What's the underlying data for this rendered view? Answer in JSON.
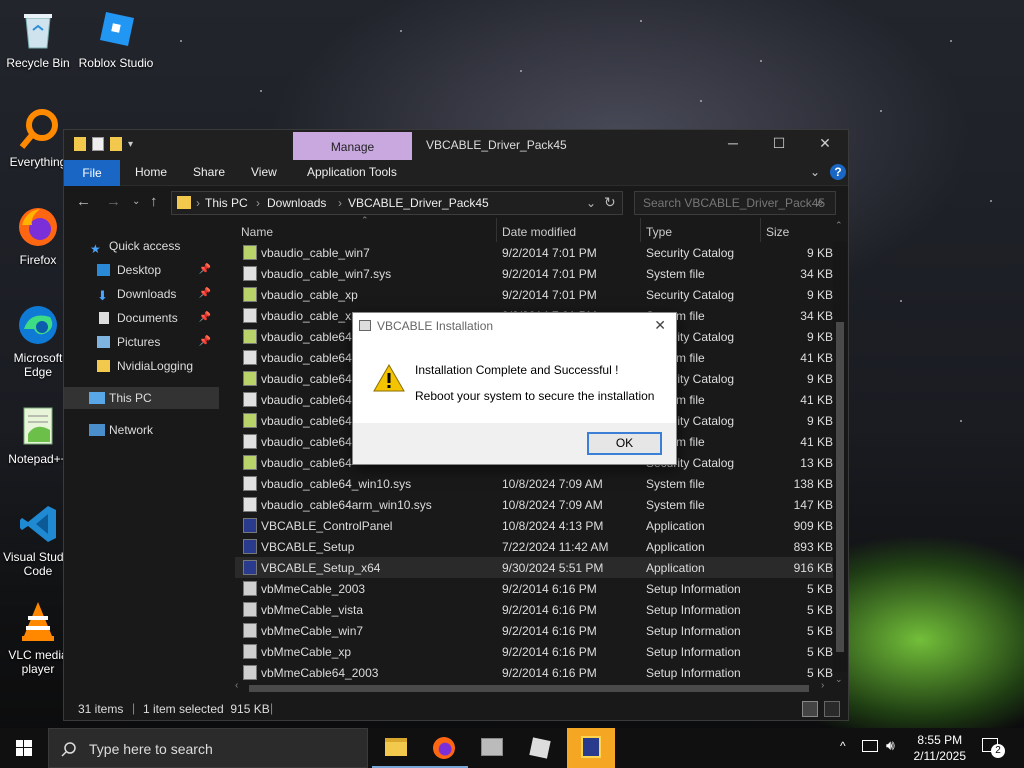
{
  "desktop": {
    "icons": [
      {
        "label": "Recycle Bin"
      },
      {
        "label": "Roblox Studio"
      },
      {
        "label": "Everything"
      },
      {
        "label": "Firefox"
      },
      {
        "label": "Microsoft Edge"
      },
      {
        "label": "Notepad++"
      },
      {
        "label": "Visual Studio Code"
      },
      {
        "label": "VLC media player"
      }
    ]
  },
  "explorer": {
    "manage_tab": "Manage",
    "title": "VBCABLE_Driver_Pack45",
    "ribbon": {
      "file": "File",
      "home": "Home",
      "share": "Share",
      "view": "View",
      "app_tools": "Application Tools"
    },
    "breadcrumb": [
      "This PC",
      "Downloads",
      "VBCABLE_Driver_Pack45"
    ],
    "search_placeholder": "Search VBCABLE_Driver_Pack45",
    "sidebar": [
      {
        "label": "Quick access"
      },
      {
        "label": "Desktop"
      },
      {
        "label": "Downloads"
      },
      {
        "label": "Documents"
      },
      {
        "label": "Pictures"
      },
      {
        "label": "NvidiaLogging"
      },
      {
        "label": "This PC"
      },
      {
        "label": "Network"
      }
    ],
    "columns": {
      "name": "Name",
      "date": "Date modified",
      "type": "Type",
      "size": "Size"
    },
    "files": [
      {
        "name": "vbaudio_cable_win7",
        "date": "9/2/2014 7:01 PM",
        "type": "Security Catalog",
        "size": "9 KB"
      },
      {
        "name": "vbaudio_cable_win7.sys",
        "date": "9/2/2014 7:01 PM",
        "type": "System file",
        "size": "34 KB"
      },
      {
        "name": "vbaudio_cable_xp",
        "date": "9/2/2014 7:01 PM",
        "type": "Security Catalog",
        "size": "9 KB"
      },
      {
        "name": "vbaudio_cable_xp.sys",
        "date": "9/2/2014 7:01 PM",
        "type": "System file",
        "size": "34 KB"
      },
      {
        "name": "vbaudio_cable64",
        "date": "",
        "type": "Security Catalog",
        "size": "9 KB"
      },
      {
        "name": "vbaudio_cable64",
        "date": "",
        "type": "System file",
        "size": "41 KB"
      },
      {
        "name": "vbaudio_cable64",
        "date": "",
        "type": "Security Catalog",
        "size": "9 KB"
      },
      {
        "name": "vbaudio_cable64",
        "date": "",
        "type": "System file",
        "size": "41 KB"
      },
      {
        "name": "vbaudio_cable64",
        "date": "",
        "type": "Security Catalog",
        "size": "9 KB"
      },
      {
        "name": "vbaudio_cable64",
        "date": "",
        "type": "System file",
        "size": "41 KB"
      },
      {
        "name": "vbaudio_cable64",
        "date": "",
        "type": "Security Catalog",
        "size": "13 KB"
      },
      {
        "name": "vbaudio_cable64_win10.sys",
        "date": "10/8/2024 7:09 AM",
        "type": "System file",
        "size": "138 KB"
      },
      {
        "name": "vbaudio_cable64arm_win10.sys",
        "date": "10/8/2024 7:09 AM",
        "type": "System file",
        "size": "147 KB"
      },
      {
        "name": "VBCABLE_ControlPanel",
        "date": "10/8/2024 4:13 PM",
        "type": "Application",
        "size": "909 KB"
      },
      {
        "name": "VBCABLE_Setup",
        "date": "7/22/2024 11:42 AM",
        "type": "Application",
        "size": "893 KB"
      },
      {
        "name": "VBCABLE_Setup_x64",
        "date": "9/30/2024 5:51 PM",
        "type": "Application",
        "size": "916 KB"
      },
      {
        "name": "vbMmeCable_2003",
        "date": "9/2/2014 6:16 PM",
        "type": "Setup Information",
        "size": "5 KB"
      },
      {
        "name": "vbMmeCable_vista",
        "date": "9/2/2014 6:16 PM",
        "type": "Setup Information",
        "size": "5 KB"
      },
      {
        "name": "vbMmeCable_win7",
        "date": "9/2/2014 6:16 PM",
        "type": "Setup Information",
        "size": "5 KB"
      },
      {
        "name": "vbMmeCable_xp",
        "date": "9/2/2014 6:16 PM",
        "type": "Setup Information",
        "size": "5 KB"
      },
      {
        "name": "vbMmeCable64_2003",
        "date": "9/2/2014 6:16 PM",
        "type": "Setup Information",
        "size": "5 KB"
      }
    ],
    "status": {
      "count": "31 items",
      "selected": "1 item selected  915 KB"
    }
  },
  "dialog": {
    "title": "VBCABLE Installation",
    "line1": "Installation Complete and Successful !",
    "line2": "Reboot your system to secure the installation",
    "ok": "OK"
  },
  "taskbar": {
    "search_placeholder": "Type here to search",
    "time": "8:55 PM",
    "date": "2/11/2025",
    "notifications": "2"
  },
  "colors": {
    "accent": "#1a66c4",
    "manage": "#c9a8e0",
    "warning": "#f5c400"
  }
}
